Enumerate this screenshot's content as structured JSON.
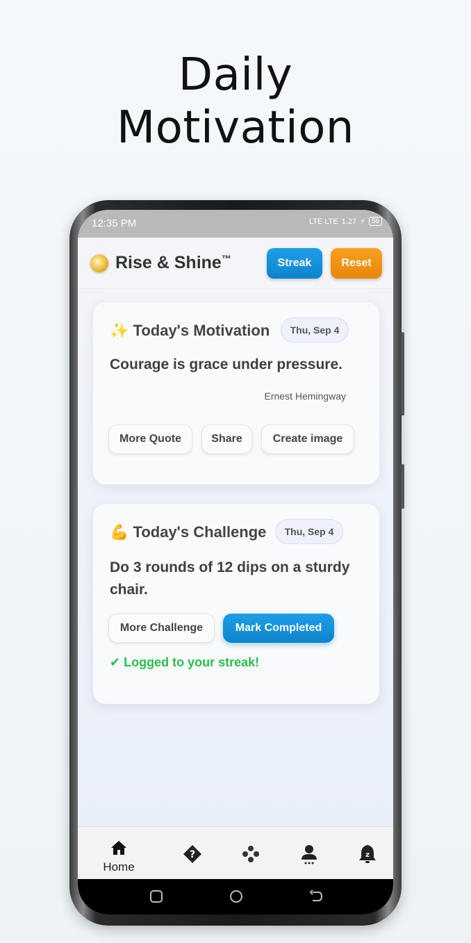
{
  "headline": {
    "line1": "Daily",
    "line2": "Motivation"
  },
  "status_bar": {
    "time": "12:35 PM",
    "network": "LTE LTE",
    "speed": "1.27",
    "battery": "56"
  },
  "app": {
    "title": "Rise & Shine",
    "trademark": "™",
    "streak_label": "Streak",
    "reset_label": "Reset"
  },
  "motivation_card": {
    "emoji": "✨",
    "title": "Today's Motivation",
    "date": "Thu, Sep 4",
    "quote": "Courage is grace under pressure.",
    "author": "Ernest Hemingway",
    "buttons": {
      "more": "More Quote",
      "share": "Share",
      "create": "Create image"
    }
  },
  "challenge_card": {
    "emoji": "💪",
    "title": "Today's Challenge",
    "date": "Thu, Sep 4",
    "line1": "Do 3 rounds of 12 dips on a sturdy",
    "line2": "chair.",
    "buttons": {
      "more": "More Challenge",
      "complete": "Mark Completed"
    },
    "status": "✔ Logged to your streak!"
  },
  "bottom_nav": {
    "items": [
      {
        "icon": "home-icon",
        "label": "Home"
      },
      {
        "icon": "question-diamond-icon"
      },
      {
        "icon": "gamepad-icon"
      },
      {
        "icon": "profile-icon"
      },
      {
        "icon": "sleep-bell-icon"
      }
    ]
  },
  "colors": {
    "accent_blue": "#1092dc",
    "accent_orange": "#f29416",
    "success_green": "#2bbf4a"
  }
}
